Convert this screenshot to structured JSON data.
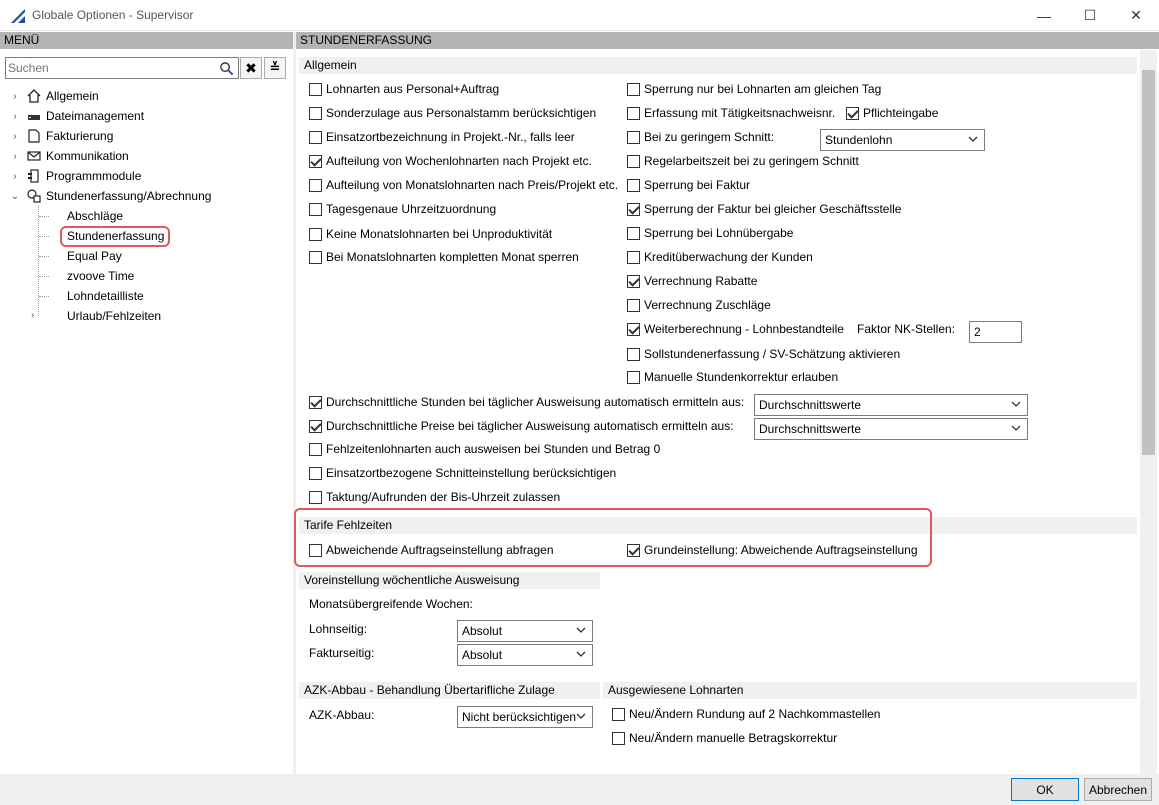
{
  "window": {
    "title": "Globale Optionen - Supervisor",
    "minimize": "—",
    "maximize": "☐",
    "close": "✕"
  },
  "menu": {
    "header": "MENÜ",
    "search_placeholder": "Suchen",
    "tree": [
      {
        "label": "Allgemein",
        "expander": "›"
      },
      {
        "label": "Dateimanagement",
        "expander": "›"
      },
      {
        "label": "Fakturierung",
        "expander": "›"
      },
      {
        "label": "Kommunikation",
        "expander": "›"
      },
      {
        "label": "Programmmodule",
        "expander": "›"
      },
      {
        "label": "Stundenerfassung/Abrechnung",
        "expander": "⌄"
      }
    ],
    "subitems": [
      "Abschläge",
      "Stundenerfassung",
      "Equal Pay",
      "zvoove Time",
      "Lohndetailliste",
      "Urlaub/Fehlzeiten"
    ],
    "sub_expander": "›"
  },
  "content": {
    "header": "STUNDENERFASSUNG",
    "allgemein": {
      "title": "Allgemein",
      "left": [
        {
          "label": "Lohnarten aus Personal+Auftrag",
          "checked": false
        },
        {
          "label": "Sonderzulage aus Personalstamm berücksichtigen",
          "checked": false
        },
        {
          "label": "Einsatzortbezeichnung in Projekt.-Nr., falls leer",
          "checked": false
        },
        {
          "label": "Aufteilung von Wochenlohnarten nach Projekt etc.",
          "checked": true
        },
        {
          "label": "Aufteilung von Monatslohnarten nach Preis/Projekt etc.",
          "checked": false
        },
        {
          "label": "Tagesgenaue Uhrzeitzuordnung",
          "checked": false
        },
        {
          "label": "Keine Monatslohnarten bei Unproduktivität",
          "checked": false
        },
        {
          "label": "Bei Monatslohnarten kompletten Monat sperren",
          "checked": false
        }
      ],
      "right": [
        {
          "label": "Sperrung nur bei Lohnarten am gleichen Tag",
          "checked": false
        },
        {
          "label": "Erfassung mit Tätigkeitsnachweisnr.",
          "checked": false
        },
        {
          "label": "Bei zu geringem Schnitt:",
          "checked": false
        },
        {
          "label": "Regelarbeitszeit bei zu geringem Schnitt",
          "checked": false
        },
        {
          "label": "Sperrung bei Faktur",
          "checked": false
        },
        {
          "label": "Sperrung der Faktur bei gleicher Geschäftsstelle",
          "checked": true
        },
        {
          "label": "Sperrung bei Lohnübergabe",
          "checked": false
        },
        {
          "label": "Kreditüberwachung der Kunden",
          "checked": false
        },
        {
          "label": "Verrechnung Rabatte",
          "checked": true
        },
        {
          "label": "Verrechnung Zuschläge",
          "checked": false
        },
        {
          "label": "Weiterberechnung - Lohnbestandteile",
          "checked": true
        },
        {
          "label": "Sollstundenerfassung / SV-Schätzung aktivieren",
          "checked": false
        },
        {
          "label": "Manuelle Stundenkorrektur erlauben",
          "checked": false
        }
      ],
      "pflichteingabe": {
        "label": "Pflichteingabe",
        "checked": true
      },
      "schnitt_combo": "Stundenlohn",
      "faktor_label": "Faktor NK-Stellen:",
      "faktor_value": "2",
      "bottom": [
        {
          "label": "Durchschnittliche Stunden bei täglicher Ausweisung automatisch ermitteln aus:",
          "checked": true
        },
        {
          "label": "Durchschnittliche Preise bei täglicher Ausweisung automatisch ermitteln aus:",
          "checked": true
        },
        {
          "label": "Fehlzeitenlohnarten auch ausweisen bei Stunden und Betrag 0",
          "checked": false
        },
        {
          "label": "Einsatzortbezogene Schnitteinstellung berücksichtigen",
          "checked": false
        },
        {
          "label": "Taktung/Aufrunden der Bis-Uhrzeit zulassen",
          "checked": false
        }
      ],
      "combo_stunden": "Durchschnittswerte",
      "combo_preise": "Durchschnittswerte"
    },
    "tarife": {
      "title": "Tarife Fehlzeiten",
      "left": {
        "label": "Abweichende Auftragseinstellung abfragen",
        "checked": false
      },
      "right": {
        "label": "Grundeinstellung: Abweichende Auftragseinstellung",
        "checked": true
      }
    },
    "voreinstellung": {
      "title": "Voreinstellung wöchentliche Ausweisung",
      "subtitle": "Monatsübergreifende Wochen:",
      "lohn_label": "Lohnseitig:",
      "lohn_value": "Absolut",
      "faktur_label": "Fakturseitig:",
      "faktur_value": "Absolut"
    },
    "azk": {
      "title": "AZK-Abbau - Behandlung Übertarifliche Zulage",
      "label": "AZK-Abbau:",
      "value": "Nicht berücksichtigen"
    },
    "lohnarten": {
      "title": "Ausgewiesene Lohnarten",
      "items": [
        {
          "label": "Neu/Ändern Rundung auf 2 Nachkommastellen",
          "checked": false
        },
        {
          "label": "Neu/Ändern manuelle Betragskorrektur",
          "checked": false
        }
      ]
    }
  },
  "buttons": {
    "ok": "OK",
    "cancel": "Abbrechen"
  },
  "colors": {
    "highlight": "#e05a5a",
    "header_bg": "#b4b4b4",
    "section_bg": "#f0f0f0"
  }
}
